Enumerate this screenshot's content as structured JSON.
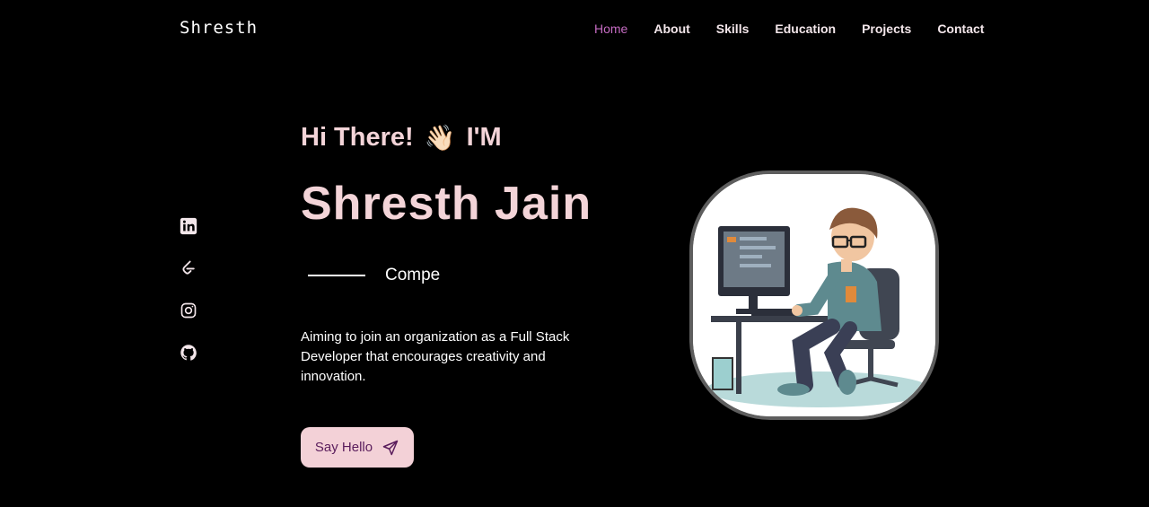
{
  "brand": "Shresth",
  "nav": {
    "items": [
      {
        "label": "Home",
        "active": true
      },
      {
        "label": "About"
      },
      {
        "label": "Skills"
      },
      {
        "label": "Education"
      },
      {
        "label": "Projects"
      },
      {
        "label": "Contact"
      }
    ]
  },
  "social": [
    "linkedin-icon",
    "leetcode-icon",
    "instagram-icon",
    "github-icon"
  ],
  "hero": {
    "greeting": "Hi There!",
    "wave_emoji": "👋🏻",
    "greeting_suffix": "I'M",
    "name": "Shresth Jain",
    "typed_text": "Compe",
    "description": "Aiming to join an organization as a Full Stack Developer that encourages creativity and innovation.",
    "button_label": "Say Hello"
  },
  "colors": {
    "background": "#000000",
    "accent_pink": "#f3d4d8",
    "active_nav": "#c56bc2",
    "button_bg": "#f3d1d7",
    "button_text": "#5a1d5c"
  }
}
